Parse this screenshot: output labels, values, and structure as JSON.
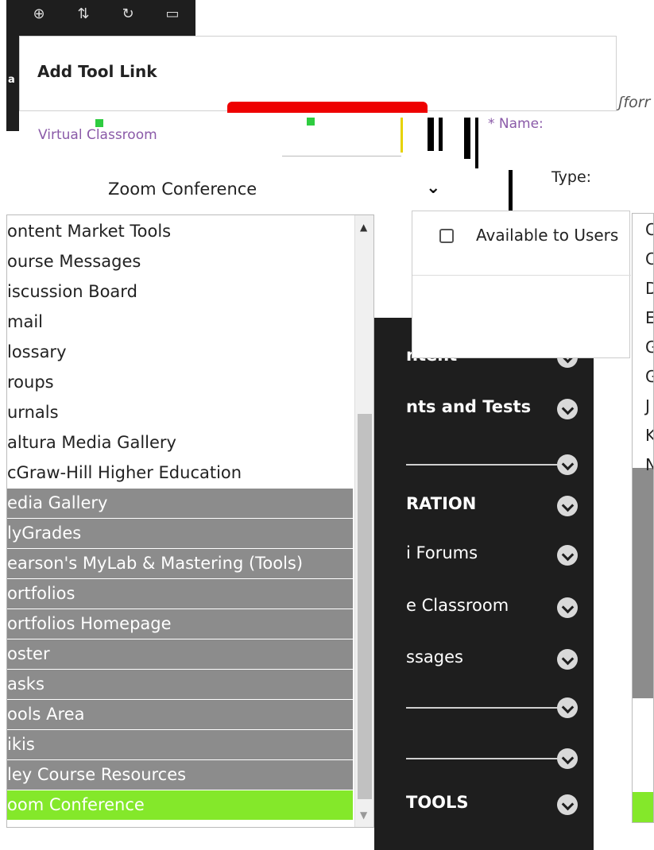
{
  "toolbar": {
    "icons": [
      "plus-circle-icon",
      "sort-icon",
      "refresh-icon",
      "folder-icon"
    ]
  },
  "dialog": {
    "title": "Add Tool Link",
    "side_fragment": "ʃforr",
    "strip_fragment": "a"
  },
  "form": {
    "name_label_left": "Virtual Classroom",
    "name_label": "* Name:",
    "type_label": "Type:",
    "select_value": "Zoom Conference",
    "available_label": "Available to Users",
    "available_checked": false
  },
  "dropdown": {
    "options": [
      {
        "label": "ontent Market Tools",
        "style": "normal"
      },
      {
        "label": "ourse Messages",
        "style": "normal"
      },
      {
        "label": "iscussion Board",
        "style": "normal"
      },
      {
        "label": "mail",
        "style": "normal"
      },
      {
        "label": "lossary",
        "style": "normal"
      },
      {
        "label": "roups",
        "style": "normal"
      },
      {
        "label": "urnals",
        "style": "normal"
      },
      {
        "label": "altura Media Gallery",
        "style": "normal"
      },
      {
        "label": "cGraw-Hill Higher Education",
        "style": "normal"
      },
      {
        "label": "edia Gallery",
        "style": "gray"
      },
      {
        "label": "lyGrades",
        "style": "gray"
      },
      {
        "label": "earson's MyLab & Mastering (Tools)",
        "style": "gray"
      },
      {
        "label": "ortfolios",
        "style": "gray"
      },
      {
        "label": "ortfolios Homepage",
        "style": "gray"
      },
      {
        "label": "oster",
        "style": "gray"
      },
      {
        "label": "asks",
        "style": "gray"
      },
      {
        "label": "ools Area",
        "style": "gray"
      },
      {
        "label": "ikis",
        "style": "gray"
      },
      {
        "label": "ley Course Resources",
        "style": "gray"
      },
      {
        "label": "oom Conference",
        "style": "selected"
      }
    ],
    "scroll_up": "▲",
    "scroll_down": "▼"
  },
  "menu": {
    "items": [
      {
        "label": "ntent",
        "bold": true
      },
      {
        "label": "nts and Tests",
        "bold": true
      },
      {
        "label": "",
        "bold": false
      },
      {
        "label": "RATION",
        "bold": true
      },
      {
        "label": "i Forums",
        "bold": false
      },
      {
        "label": "e Classroom",
        "bold": false
      },
      {
        "label": "ssages",
        "bold": false
      },
      {
        "label": "",
        "bold": false
      },
      {
        "label": "",
        "bold": false
      },
      {
        "label": "TOOLS",
        "bold": true
      }
    ]
  },
  "right_list": {
    "letters": [
      "C",
      "C",
      "D",
      "E",
      "G",
      "G",
      "J",
      "K",
      "N"
    ]
  },
  "colors": {
    "selected": "#84e82a",
    "gray_rows": "#8c8c8c",
    "menu_bg": "#1e1e1e",
    "alert": "#e00000",
    "label_purple": "#8a5aa8"
  }
}
